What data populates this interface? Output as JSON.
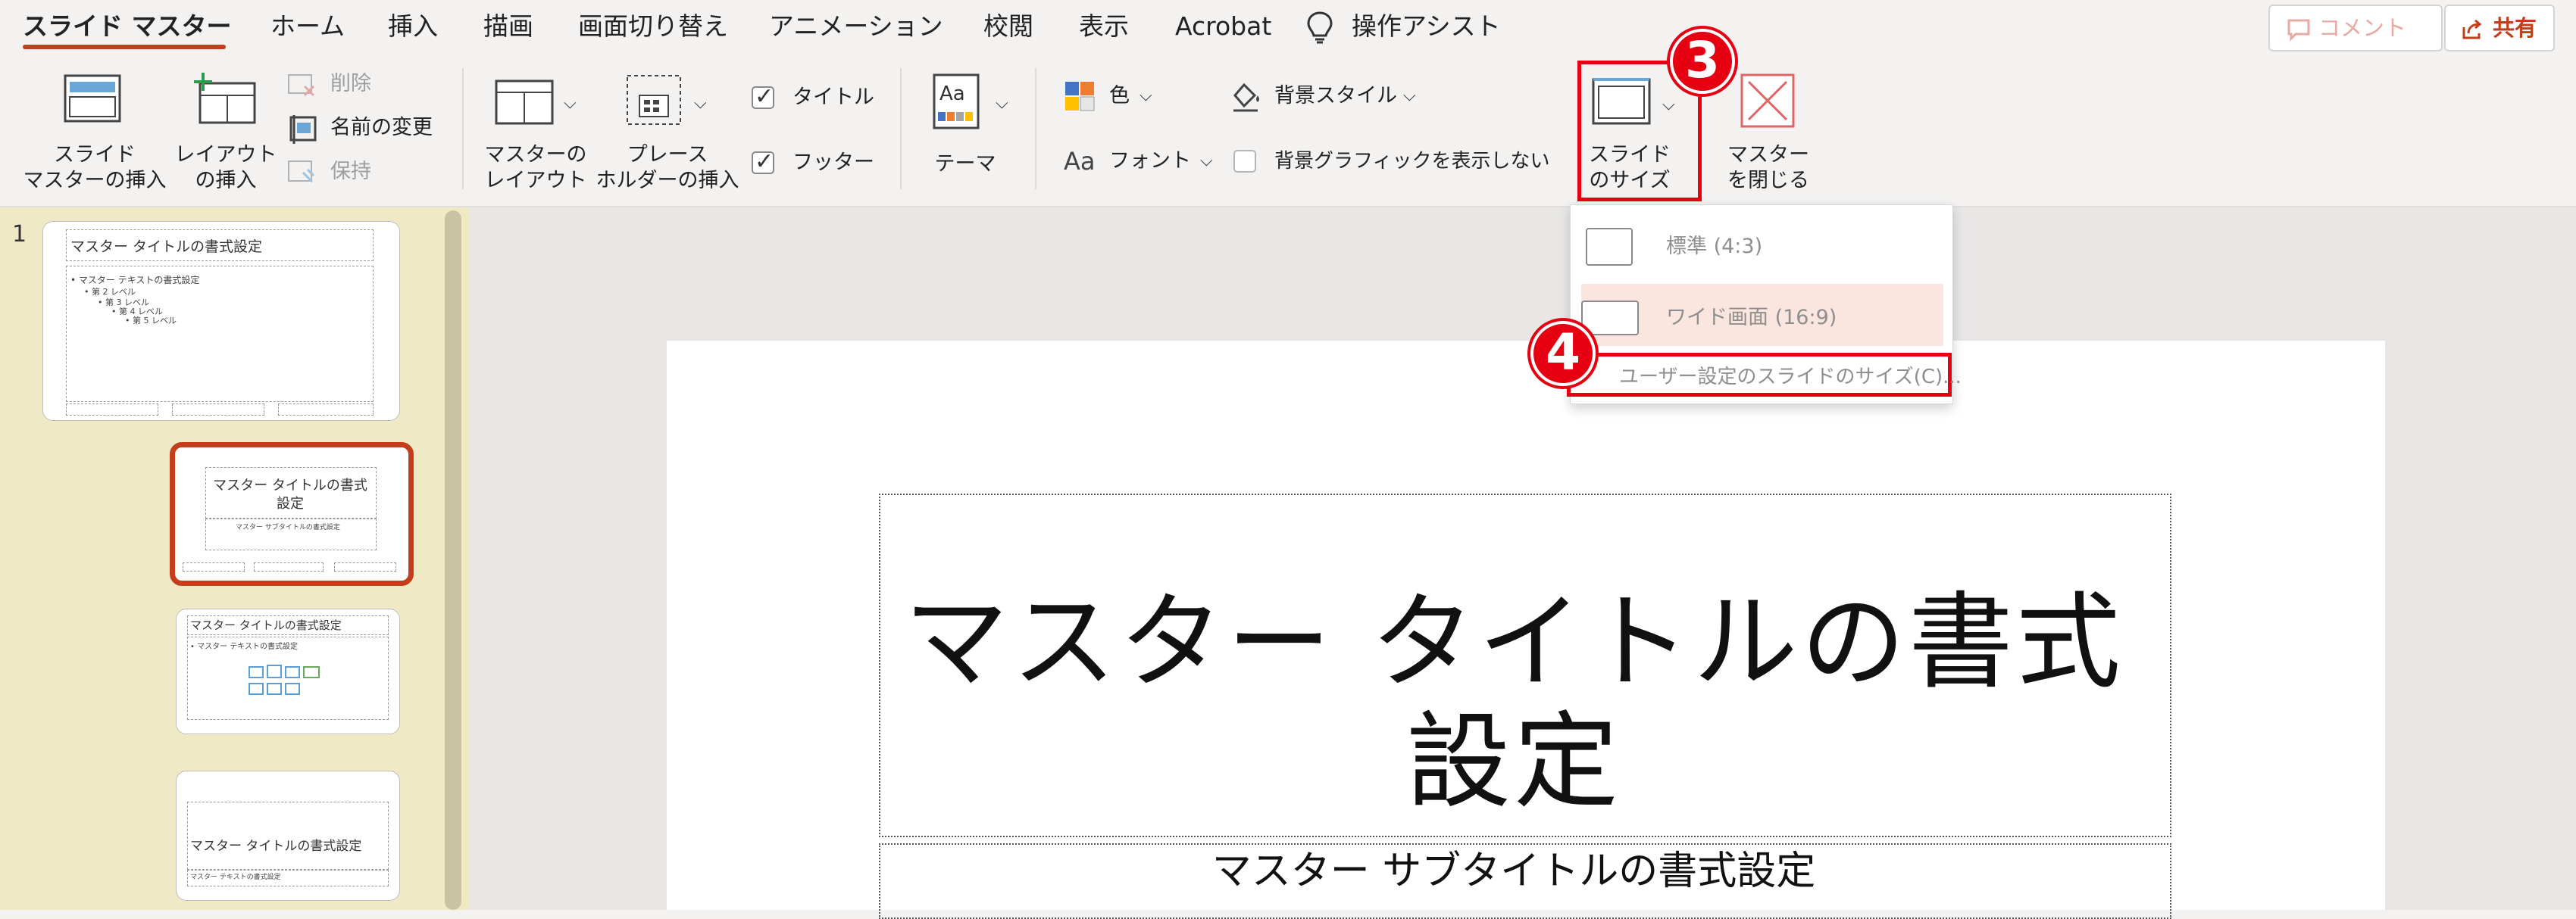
{
  "tabs": [
    "スライド マスター",
    "ホーム",
    "挿入",
    "描画",
    "画面切り替え",
    "アニメーション",
    "校閲",
    "表示",
    "Acrobat"
  ],
  "active_tab": "スライド マスター",
  "tell_me": "操作アシスト",
  "comment_button": "コメント",
  "share_button": "共有",
  "ribbon": {
    "insert_master": [
      "スライド",
      "マスターの挿入"
    ],
    "insert_layout": [
      "レイアウト",
      "の挿入"
    ],
    "delete": "削除",
    "rename": "名前の変更",
    "preserve": "保持",
    "master_layout": [
      "マスターの",
      "レイアウト"
    ],
    "insert_placeholder": [
      "プレース",
      "ホルダーの挿入"
    ],
    "title_checkbox": "タイトル",
    "footer_checkbox": "フッター",
    "theme": "テーマ",
    "colors": "色",
    "fonts": "フォント",
    "background_styles": "背景スタイル",
    "hide_background_graphics": "背景グラフィックを表示しない",
    "slide_size": [
      "スライド",
      "のサイズ"
    ],
    "close_master": [
      "マスター",
      "を閉じる"
    ]
  },
  "dropdown": {
    "standard": "標準 (4:3)",
    "widescreen": "ワイド画面 (16:9)",
    "custom": "ユーザー設定のスライドのサイズ(C)..."
  },
  "badges": {
    "slide_size_step": "3",
    "custom_size_step": "4"
  },
  "thumbnails": {
    "number": "1",
    "master_title": "マスター タイトルの書式設定",
    "master_text": "• マスター テキストの書式設定",
    "levels": [
      "• 第 2 レベル",
      "• 第 3 レベル",
      "• 第 4 レベル",
      "• 第 5 レベル"
    ],
    "layout_title": [
      "マスター タイトルの書式",
      "設定"
    ],
    "layout_subtitle": "マスター サブタイトルの書式設定",
    "content_title": "マスター タイトルの書式設定",
    "content_text": "• マスター テキストの書式設定",
    "section_title": "マスター タイトルの書式設定",
    "section_text": "マスター テキストの書式設定"
  },
  "slide": {
    "title_line1": "マスター タイトルの書式",
    "title_line2": "設定",
    "subtitle": "マスター サブタイトルの書式設定"
  },
  "colors": {
    "accent": "#c43e1c",
    "highlight": "#e60012",
    "thumb_pane": "#efe9c6"
  }
}
